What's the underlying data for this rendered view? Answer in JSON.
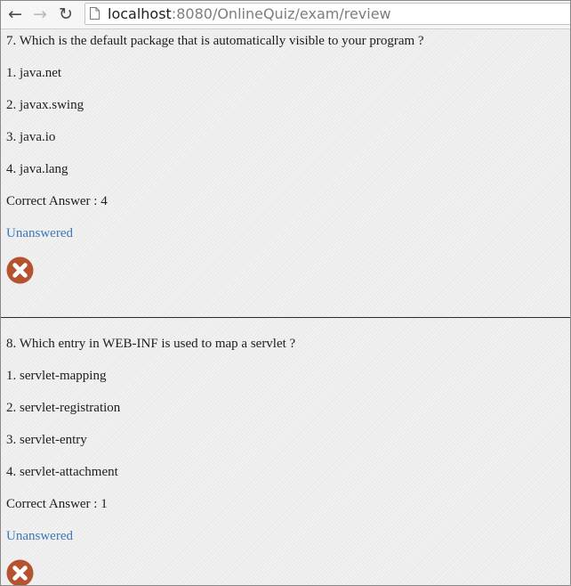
{
  "browser": {
    "url_host": "localhost",
    "url_rest": ":8080/OnlineQuiz/exam/review",
    "back_glyph": "←",
    "forward_glyph": "→",
    "reload_glyph": "↻"
  },
  "questions": [
    {
      "text": "7. Which is the default package that is automatically visible to your program ?",
      "options": [
        "1. java.net",
        "2. javax.swing",
        "3. java.io",
        "4. java.lang"
      ],
      "correct_answer": "Correct Answer : 4",
      "status": "Unanswered",
      "result_icon": "wrong-icon"
    },
    {
      "text": "8. Which entry in WEB-INF is used to map a servlet ?",
      "options": [
        "1. servlet-mapping",
        "2. servlet-registration",
        "3. servlet-entry",
        "4. servlet-attachment"
      ],
      "correct_answer": "Correct Answer : 1",
      "status": "Unanswered",
      "result_icon": "wrong-icon"
    }
  ],
  "colors": {
    "status_link": "#3b78b8",
    "wrong_icon": "#b5522f"
  }
}
